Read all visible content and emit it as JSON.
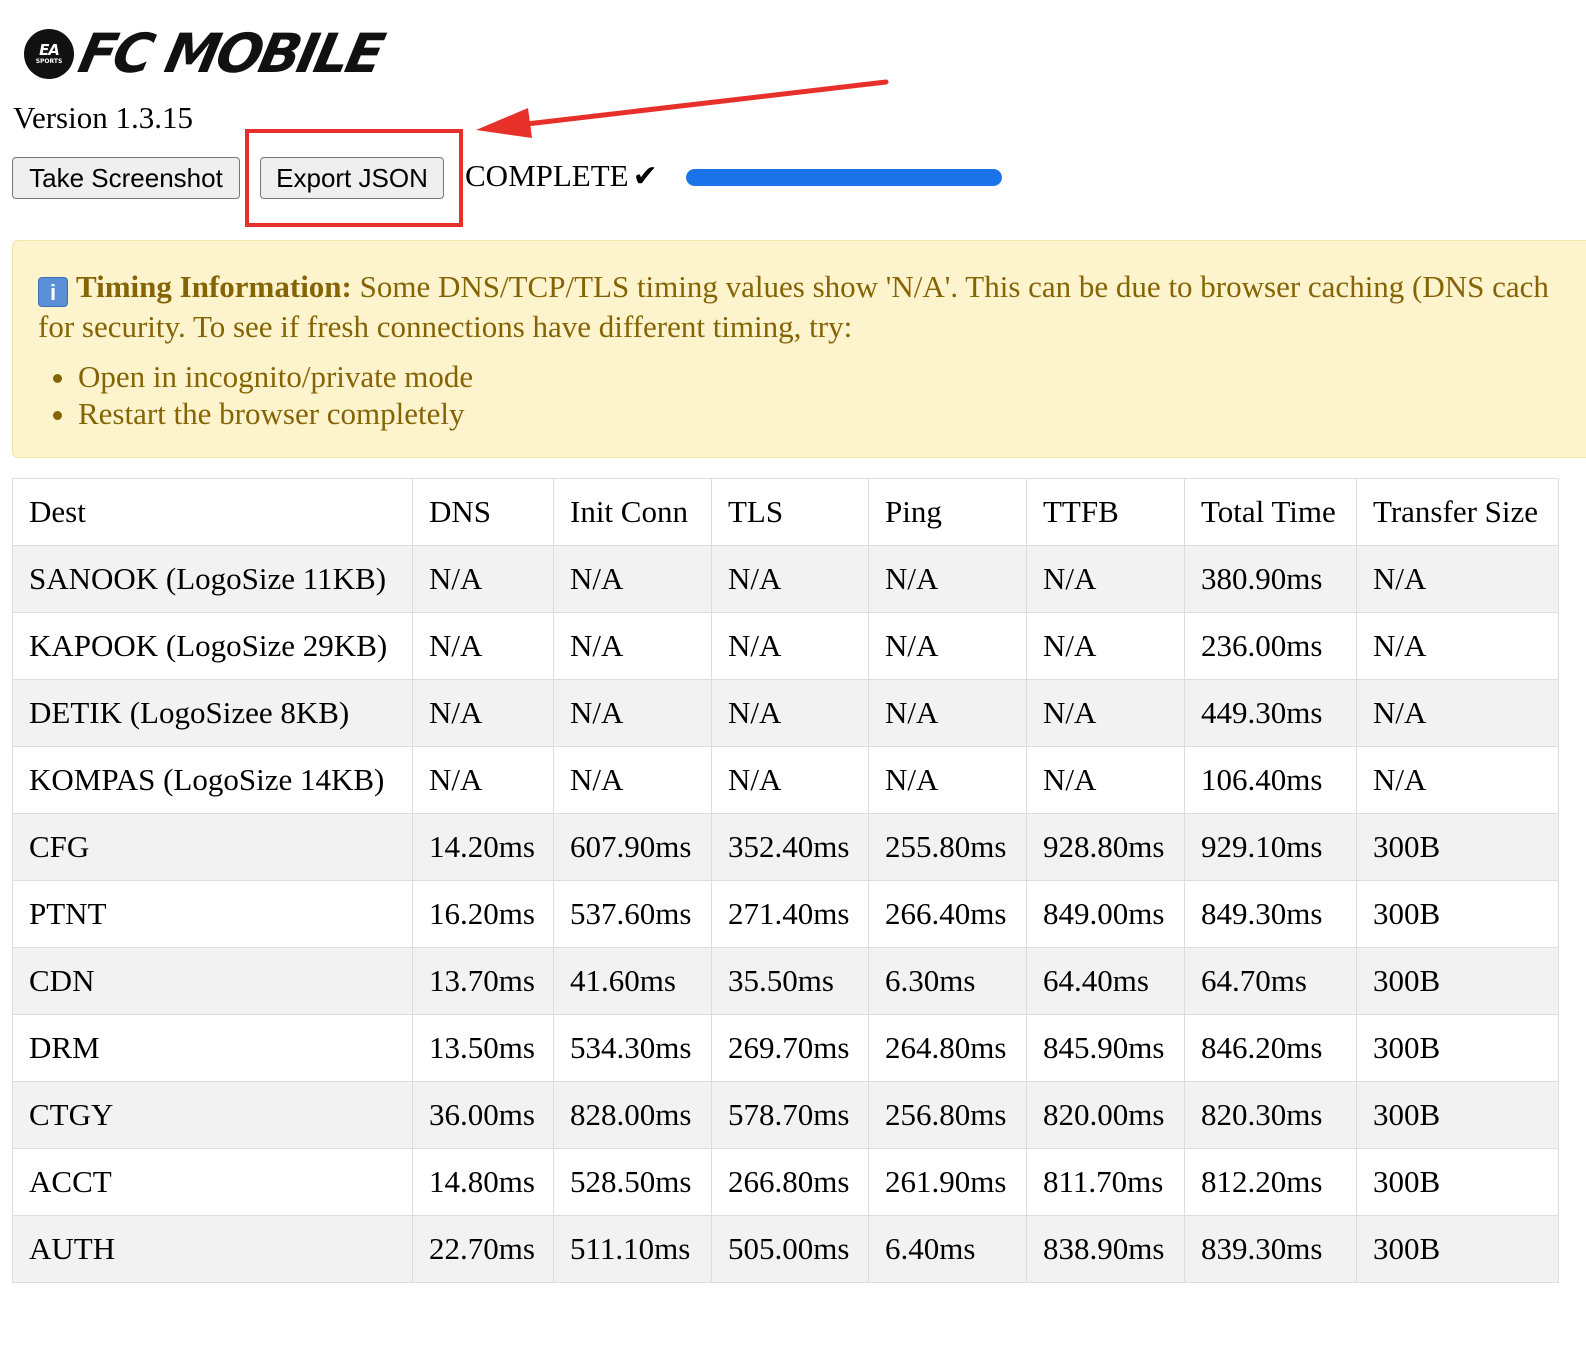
{
  "brand": {
    "ea_label": "EA",
    "sports_label": "SPORTS",
    "title": "FC MOBILE"
  },
  "version": "Version 1.3.15",
  "toolbar": {
    "screenshot_label": "Take Screenshot",
    "export_label": "Export JSON"
  },
  "status": {
    "text": "COMPLETE",
    "check": "✔",
    "progress": 1.0
  },
  "colors": {
    "progress": "#1a73e8",
    "annotation": "#e8302a",
    "notice_bg": "#fdf3cd",
    "notice_text": "#856404"
  },
  "notice": {
    "icon": "info-icon",
    "icon_glyph": "i",
    "title": "Timing Information:",
    "line1": "Some DNS/TCP/TLS timing values show 'N/A'. This can be due to browser caching (DNS cach",
    "line2": "for security. To see if fresh connections have different timing, try:",
    "bullets": [
      "Open in incognito/private mode",
      "Restart the browser completely"
    ]
  },
  "table": {
    "headers": [
      "Dest",
      "DNS",
      "Init Conn",
      "TLS",
      "Ping",
      "TTFB",
      "Total Time",
      "Transfer Size"
    ],
    "rows": [
      [
        "SANOOK (LogoSize 11KB)",
        "N/A",
        "N/A",
        "N/A",
        "N/A",
        "N/A",
        "380.90ms",
        "N/A"
      ],
      [
        "KAPOOK (LogoSize 29KB)",
        "N/A",
        "N/A",
        "N/A",
        "N/A",
        "N/A",
        "236.00ms",
        "N/A"
      ],
      [
        "DETIK (LogoSizee 8KB)",
        "N/A",
        "N/A",
        "N/A",
        "N/A",
        "N/A",
        "449.30ms",
        "N/A"
      ],
      [
        "KOMPAS (LogoSize 14KB)",
        "N/A",
        "N/A",
        "N/A",
        "N/A",
        "N/A",
        "106.40ms",
        "N/A"
      ],
      [
        "CFG",
        "14.20ms",
        "607.90ms",
        "352.40ms",
        "255.80ms",
        "928.80ms",
        "929.10ms",
        "300B"
      ],
      [
        "PTNT",
        "16.20ms",
        "537.60ms",
        "271.40ms",
        "266.40ms",
        "849.00ms",
        "849.30ms",
        "300B"
      ],
      [
        "CDN",
        "13.70ms",
        "41.60ms",
        "35.50ms",
        "6.30ms",
        "64.40ms",
        "64.70ms",
        "300B"
      ],
      [
        "DRM",
        "13.50ms",
        "534.30ms",
        "269.70ms",
        "264.80ms",
        "845.90ms",
        "846.20ms",
        "300B"
      ],
      [
        "CTGY",
        "36.00ms",
        "828.00ms",
        "578.70ms",
        "256.80ms",
        "820.00ms",
        "820.30ms",
        "300B"
      ],
      [
        "ACCT",
        "14.80ms",
        "528.50ms",
        "266.80ms",
        "261.90ms",
        "811.70ms",
        "812.20ms",
        "300B"
      ],
      [
        "AUTH",
        "22.70ms",
        "511.10ms",
        "505.00ms",
        "6.40ms",
        "838.90ms",
        "839.30ms",
        "300B"
      ]
    ]
  }
}
